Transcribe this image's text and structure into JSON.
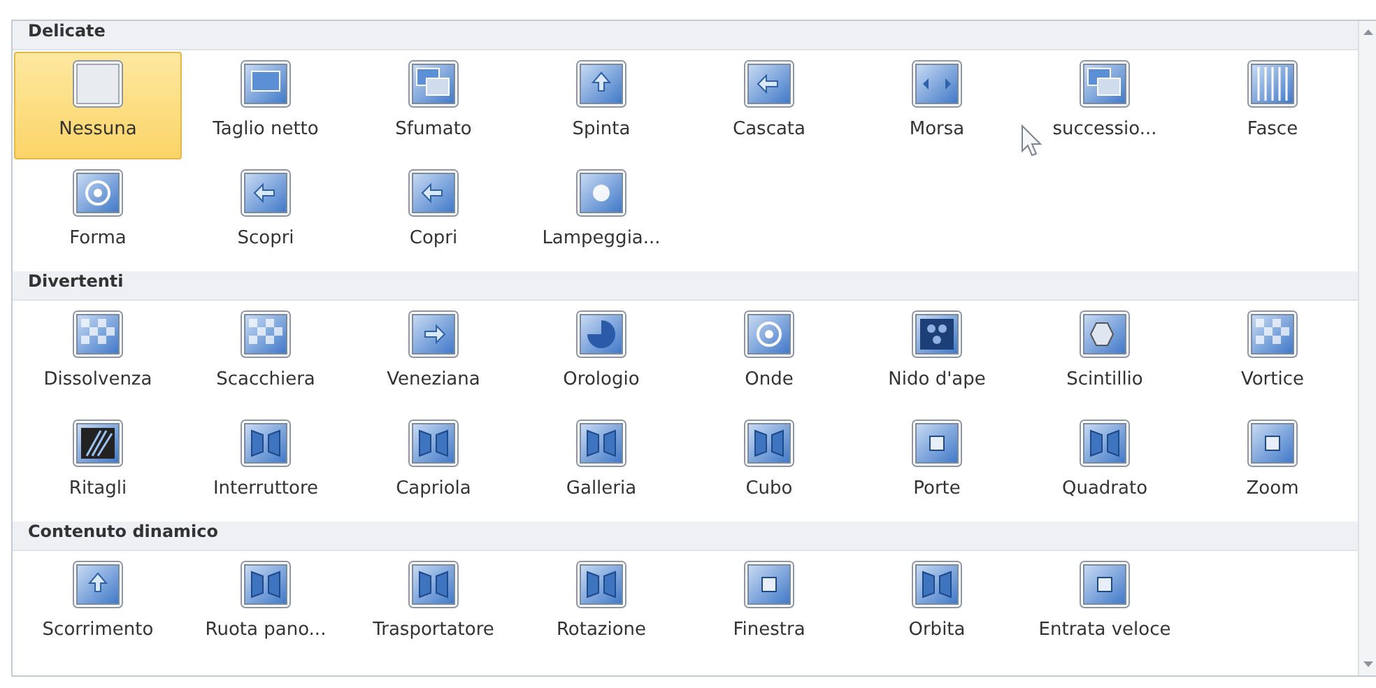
{
  "sections": [
    {
      "title": "Delicate",
      "items": [
        {
          "label": "Nessuna",
          "selected": true
        },
        {
          "label": "Taglio netto",
          "selected": false
        },
        {
          "label": "Sfumato",
          "selected": false
        },
        {
          "label": "Spinta",
          "selected": false
        },
        {
          "label": "Cascata",
          "selected": false
        },
        {
          "label": "Morsa",
          "selected": false
        },
        {
          "label": "successio...",
          "selected": false
        },
        {
          "label": "Fasce",
          "selected": false
        },
        {
          "label": "Forma",
          "selected": false
        },
        {
          "label": "Scopri",
          "selected": false
        },
        {
          "label": "Copri",
          "selected": false
        },
        {
          "label": "Lampeggia...",
          "selected": false
        }
      ]
    },
    {
      "title": "Divertenti",
      "items": [
        {
          "label": "Dissolvenza",
          "selected": false
        },
        {
          "label": "Scacchiera",
          "selected": false
        },
        {
          "label": "Veneziana",
          "selected": false
        },
        {
          "label": "Orologio",
          "selected": false
        },
        {
          "label": "Onde",
          "selected": false
        },
        {
          "label": "Nido d'ape",
          "selected": false
        },
        {
          "label": "Scintillio",
          "selected": false
        },
        {
          "label": "Vortice",
          "selected": false
        },
        {
          "label": "Ritagli",
          "selected": false
        },
        {
          "label": "Interruttore",
          "selected": false
        },
        {
          "label": "Capriola",
          "selected": false
        },
        {
          "label": "Galleria",
          "selected": false
        },
        {
          "label": "Cubo",
          "selected": false
        },
        {
          "label": "Porte",
          "selected": false
        },
        {
          "label": "Quadrato",
          "selected": false
        },
        {
          "label": "Zoom",
          "selected": false
        }
      ]
    },
    {
      "title": "Contenuto dinamico",
      "items": [
        {
          "label": "Scorrimento",
          "selected": false
        },
        {
          "label": "Ruota pano...",
          "selected": false
        },
        {
          "label": "Trasportatore",
          "selected": false
        },
        {
          "label": "Rotazione",
          "selected": false
        },
        {
          "label": "Finestra",
          "selected": false
        },
        {
          "label": "Orbita",
          "selected": false
        },
        {
          "label": "Entrata veloce",
          "selected": false
        }
      ]
    }
  ]
}
